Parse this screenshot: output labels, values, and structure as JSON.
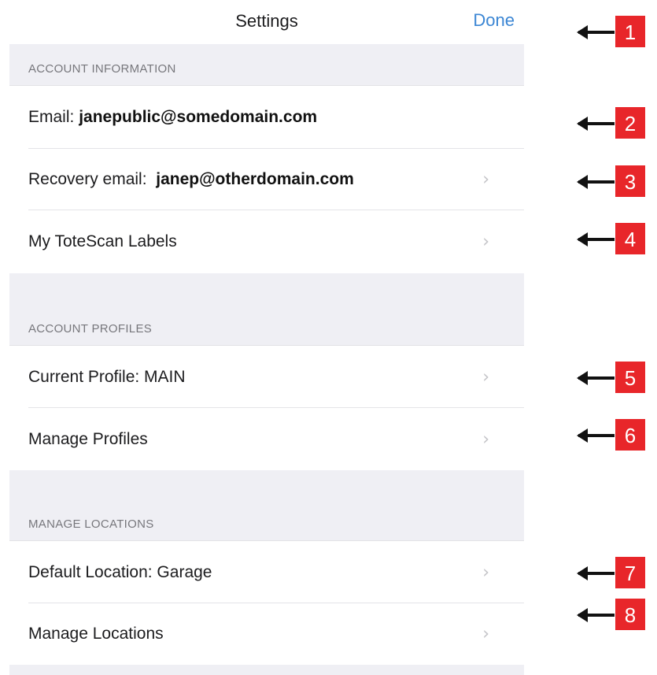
{
  "navbar": {
    "title": "Settings",
    "done_label": "Done"
  },
  "sections": {
    "account_information": {
      "header": "ACCOUNT INFORMATION",
      "email_label": "Email:",
      "email_value": "janepublic@somedomain.com",
      "recovery_label": "Recovery email:",
      "recovery_value": "janep@otherdomain.com",
      "labels_item": "My ToteScan Labels"
    },
    "account_profiles": {
      "header": "ACCOUNT PROFILES",
      "current_profile": "Current Profile: MAIN",
      "manage_profiles": "Manage Profiles"
    },
    "manage_locations": {
      "header": "MANAGE LOCATIONS",
      "default_location": "Default Location: Garage",
      "manage_locations": "Manage Locations"
    }
  },
  "callouts": [
    "1",
    "2",
    "3",
    "4",
    "5",
    "6",
    "7",
    "8"
  ],
  "colors": {
    "accent": "#3b86d4",
    "callout": "#e8262a",
    "group_bg": "#efeff4"
  },
  "icons": {
    "chevron": "chevron-right-icon",
    "arrow": "arrow-left-icon"
  }
}
